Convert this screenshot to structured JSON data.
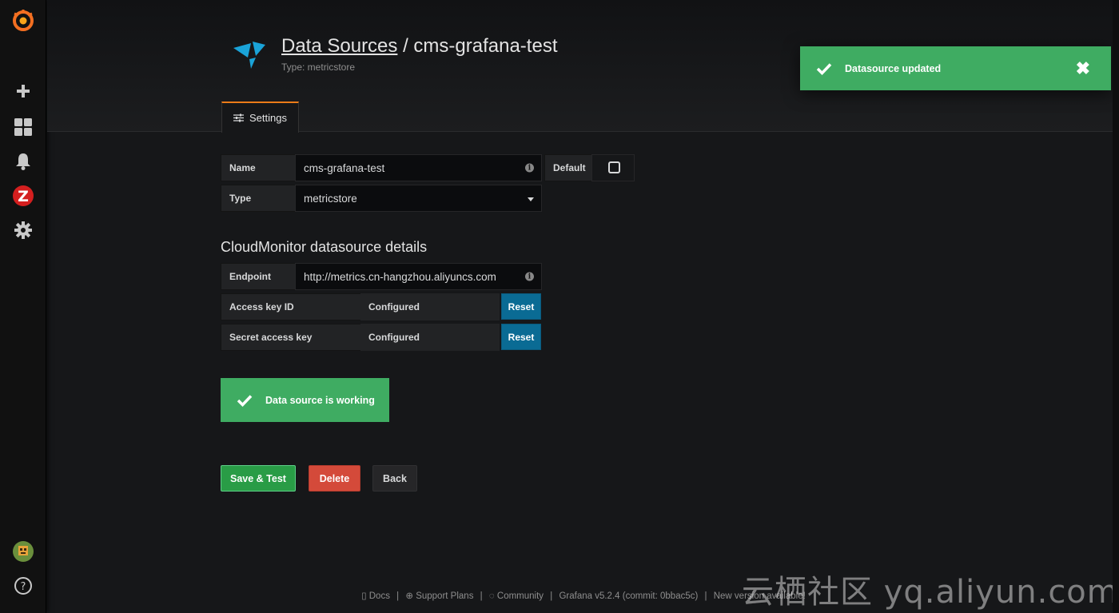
{
  "header": {
    "breadcrumb_link": "Data Sources",
    "separator": " / ",
    "title": "cms-grafana-test",
    "subtitle": "Type: metricstore",
    "tab_settings": "Settings"
  },
  "form": {
    "name_label": "Name",
    "name_value": "cms-grafana-test",
    "default_label": "Default",
    "default_checked": false,
    "type_label": "Type",
    "type_value": "metricstore"
  },
  "details": {
    "section_title": "CloudMonitor datasource details",
    "endpoint_label": "Endpoint",
    "endpoint_value": "http://metrics.cn-hangzhou.aliyuncs.com",
    "access_key_label": "Access key ID",
    "access_key_value": "Configured",
    "secret_key_label": "Secret access key",
    "secret_key_value": "Configured",
    "reset_label": "Reset"
  },
  "alert": {
    "working_text": "Data source is working"
  },
  "buttons": {
    "save": "Save & Test",
    "delete": "Delete",
    "back": "Back"
  },
  "toast": {
    "text": "Datasource updated",
    "close": "✖"
  },
  "footer": {
    "docs": "Docs",
    "support": "Support Plans",
    "community": "Community",
    "version": "Grafana v5.2.4 (commit: 0bbac5c)",
    "new_version": "New version available!",
    "pipe": "|"
  },
  "watermark": "云栖社区 yq.aliyun.com",
  "colors": {
    "background": "#161719",
    "success": "#3fac62",
    "primary": "#0a6b94",
    "danger": "#d44a3a",
    "accent": "#eb7b18"
  },
  "icons": {
    "sidebar": [
      "grafana-logo-icon",
      "plus-icon",
      "dashboards-icon",
      "bell-icon",
      "zabbix-icon",
      "gear-icon",
      "avatar",
      "help-icon"
    ]
  }
}
